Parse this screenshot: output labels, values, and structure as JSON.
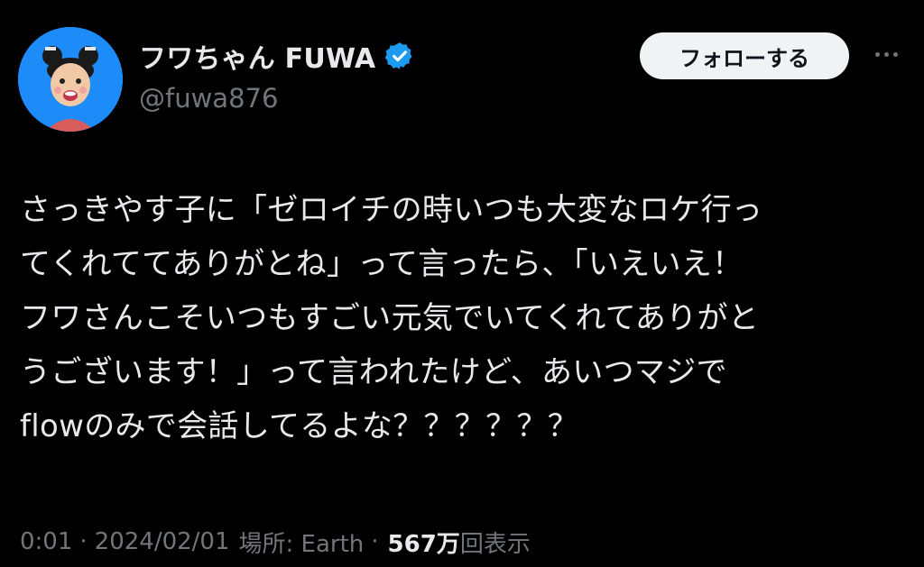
{
  "author": {
    "display_name": "フワちゃん FUWA",
    "handle": "@fuwa876",
    "verified_icon": "verified-badge-icon",
    "avatar_bg": "#1d8cf8"
  },
  "actions": {
    "follow_label": "フォローする",
    "more_icon": "more-options-icon"
  },
  "tweet": {
    "lines": [
      "さっきやす子に「ゼロイチの時いつも大変なロケ行っ",
      "てくれててありがとね」って言ったら、「いえいえ！",
      "フワさんこそいつもすごい元気でいてくれてありがと",
      "うございます！」って言われたけど、あいつマジで",
      "flowのみで会話してるよな？？？？？？"
    ]
  },
  "meta": {
    "time": "0:01",
    "separator": "·",
    "date": "2024/02/01",
    "location": "場所: Earth",
    "views_count": "567万",
    "views_label": "回表示"
  },
  "colors": {
    "background": "#000000",
    "text_primary": "#e7e9ea",
    "text_secondary": "#71767b",
    "verified_blue": "#1d9bf0",
    "follow_bg": "#eff3f4"
  }
}
